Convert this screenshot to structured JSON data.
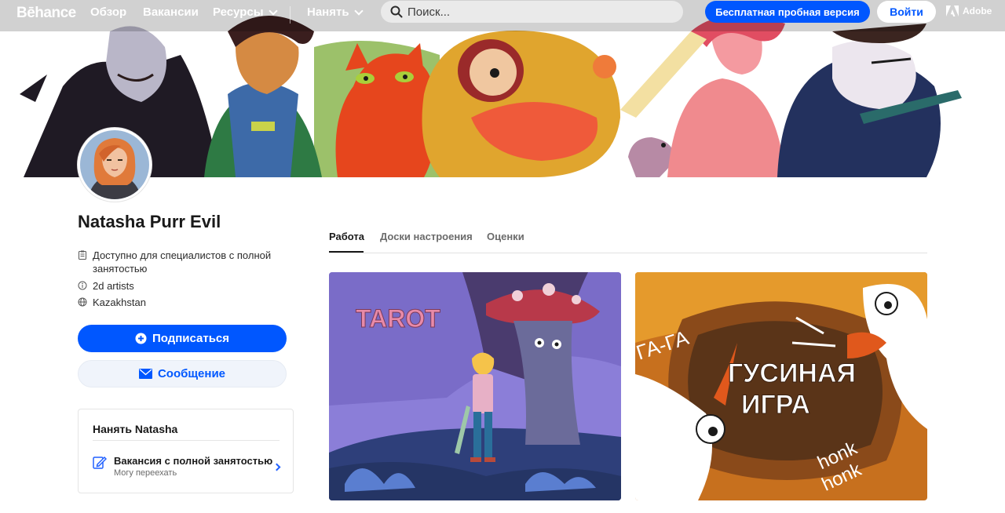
{
  "nav": {
    "logo": "Bēhance",
    "links": [
      "Обзор",
      "Вакансии",
      "Ресурсы",
      "Нанять"
    ],
    "search_placeholder": "Поиск...",
    "trial_button": "Бесплатная пробная версия",
    "login_button": "Войти",
    "adobe_label": "Adobe"
  },
  "profile": {
    "name": "Natasha Purr Evil",
    "availability": "Доступно для специалистов с полной занятостью",
    "occupation": "2d artists",
    "location": "Kazakhstan",
    "follow_button": "Подписаться",
    "message_button": "Сообщение"
  },
  "hire": {
    "title": "Нанять Natasha",
    "item_title": "Вакансия с полной занятостью",
    "item_subtitle": "Могу переехать"
  },
  "tabs": [
    "Работа",
    "Доски настроения",
    "Оценки"
  ],
  "projects": [
    {
      "cover_text": "TAROT"
    },
    {
      "cover_text_1": "ГА-ГА",
      "cover_text_2": "ГУСИНАЯ",
      "cover_text_3": "ИГРА",
      "cover_text_4": "honk",
      "cover_text_5": "honk"
    }
  ],
  "colors": {
    "accent": "#0057ff",
    "text": "#191919",
    "muted": "#6b6b6b"
  }
}
